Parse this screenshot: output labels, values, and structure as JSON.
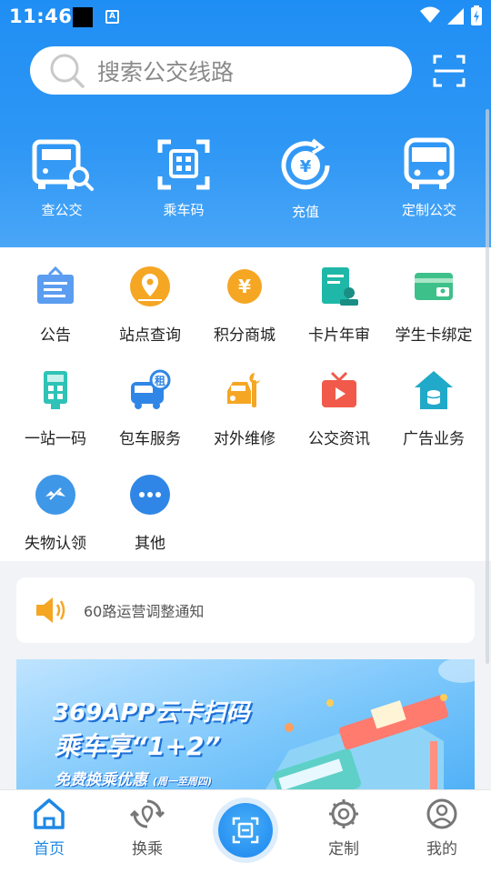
{
  "status": {
    "time": "11:46",
    "a_label": "A"
  },
  "search": {
    "placeholder": "搜索公交线路"
  },
  "quick": [
    {
      "label": "查公交",
      "icon": "bus-search-icon"
    },
    {
      "label": "乘车码",
      "icon": "qr-ride-icon"
    },
    {
      "label": "充值",
      "icon": "yuan-recharge-icon"
    },
    {
      "label": "定制公交",
      "icon": "bus-icon"
    }
  ],
  "grid": [
    {
      "label": "公告",
      "icon": "notice-board-icon",
      "color": "#5b9df0"
    },
    {
      "label": "站点查询",
      "icon": "map-pin-icon",
      "color": "#f5a623"
    },
    {
      "label": "积分商城",
      "icon": "yuan-coin-icon",
      "color": "#f5a623"
    },
    {
      "label": "卡片年审",
      "icon": "card-review-icon",
      "color": "#1fb8a8"
    },
    {
      "label": "学生卡绑定",
      "icon": "student-card-icon",
      "color": "#3ec08a"
    },
    {
      "label": "一站一码",
      "icon": "station-code-icon",
      "color": "#2ec3b6"
    },
    {
      "label": "包车服务",
      "icon": "charter-bus-icon",
      "color": "#2f86e6"
    },
    {
      "label": "对外维修",
      "icon": "repair-icon",
      "color": "#f5a623"
    },
    {
      "label": "公交资讯",
      "icon": "tv-news-icon",
      "color": "#f15a4a"
    },
    {
      "label": "广告业务",
      "icon": "ad-house-icon",
      "color": "#20a9c8"
    },
    {
      "label": "失物认领",
      "icon": "lost-found-icon",
      "color": "#3f97e8"
    },
    {
      "label": "其他",
      "icon": "more-icon",
      "color": "#2f86e6"
    }
  ],
  "grid_badge": "租",
  "notice": {
    "text": "60路运营调整通知"
  },
  "banner": {
    "line1": "369APP云卡扫码",
    "line2": "乘车享“1+2”",
    "line3": "免费换乘优惠",
    "line3_note": "(周一至周四)"
  },
  "tabs": [
    {
      "label": "首页",
      "icon": "home-icon",
      "active": true
    },
    {
      "label": "换乘",
      "icon": "transfer-icon",
      "active": false
    },
    {
      "label": "定制",
      "icon": "custom-icon",
      "active": false
    },
    {
      "label": "我的",
      "icon": "profile-icon",
      "active": false
    }
  ],
  "colors": {
    "primary": "#1e88e5",
    "header": "#2f97f5"
  }
}
